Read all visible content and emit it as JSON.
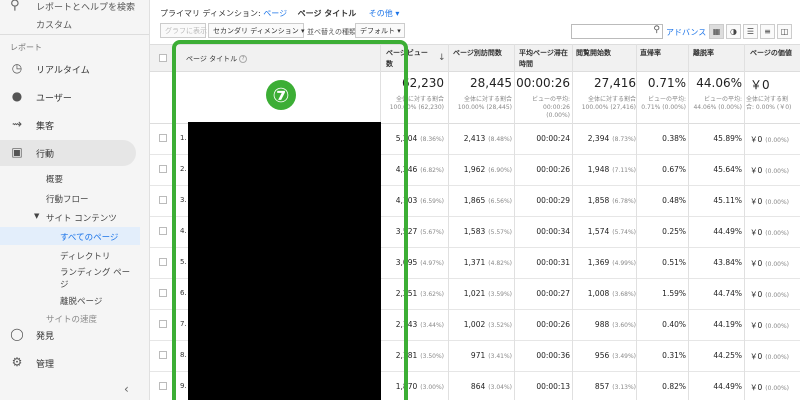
{
  "sidebar": {
    "search_text": "レポートとヘルプを検索",
    "cut_text": "カスタム",
    "section_label": "レポート",
    "items": [
      {
        "label": "リアルタイム",
        "icon": "clock-icon"
      },
      {
        "label": "ユーザー",
        "icon": "person-icon"
      },
      {
        "label": "集客",
        "icon": "acquisition-icon"
      },
      {
        "label": "行動",
        "icon": "behavior-icon"
      }
    ],
    "sub_items": {
      "overview": "概要",
      "flow": "行動フロー",
      "site_content": "サイト コンテンツ",
      "all_pages": "すべてのページ",
      "directory": "ディレクトリ",
      "landing_1": "ランディング ペー",
      "landing_2": "ジ",
      "exit": "離脱ページ",
      "site_speed": "サイトの速度"
    },
    "discover": "発見",
    "admin": "管理"
  },
  "dimbar": {
    "primary": "プライマリ ディメンション:",
    "page_link": "ページ",
    "page_title": "ページ タイトル",
    "other": "その他"
  },
  "toolbar": {
    "plot_rows": "グラフに表示",
    "secondary": "セカンダリ ディメンション",
    "sort_label": "並べ替えの種類:",
    "sort_value": "デフォルト",
    "advanced": "アドバンス"
  },
  "table": {
    "headers": {
      "page_title": "ページ タイトル",
      "pageviews": "ページビュー数",
      "unique": "ページ別訪問数",
      "avg_time_1": "平均ページ滞在",
      "avg_time_2": "時間",
      "entrances": "閲覧開始数",
      "bounce": "直帰率",
      "exit": "離脱率",
      "value": "ページの価値"
    },
    "totals": {
      "pageviews": "62,230",
      "pageviews_sub1": "全体に対する割合",
      "pageviews_sub2": "100.00% (62,230)",
      "unique": "28,445",
      "unique_sub1": "全体に対する割合",
      "unique_sub2": "100.00% (28,445)",
      "avg": "00:00:26",
      "avg_sub1": "ビューの平均:",
      "avg_sub2": "00:00:26",
      "avg_sub3": "(0.00%)",
      "entrances": "27,416",
      "entrances_sub1": "全体に対する割合",
      "entrances_sub2": "100.00% (27,416)",
      "bounce": "0.71%",
      "bounce_sub1": "ビューの平均:",
      "bounce_sub2": "0.71% (0.00%)",
      "exit": "44.06%",
      "exit_sub1": "ビューの平均:",
      "exit_sub2": "44.06% (0.00%)",
      "value": "￥0",
      "value_sub1": "全体に対する割",
      "value_sub2": "合: 0.00% (￥0)"
    },
    "rows": [
      {
        "idx": "1.",
        "pv": "5,204",
        "pv_pct": "(8.36%)",
        "uq": "2,413",
        "uq_pct": "(8.48%)",
        "avg": "00:00:24",
        "en": "2,394",
        "en_pct": "(8.73%)",
        "br": "0.38%",
        "ex": "45.89%",
        "val": "￥0",
        "val_pct": "(0.00%)"
      },
      {
        "idx": "2.",
        "pv": "4,246",
        "pv_pct": "(6.82%)",
        "uq": "1,962",
        "uq_pct": "(6.90%)",
        "avg": "00:00:26",
        "en": "1,948",
        "en_pct": "(7.11%)",
        "br": "0.67%",
        "ex": "45.64%",
        "val": "￥0",
        "val_pct": "(0.00%)"
      },
      {
        "idx": "3.",
        "pv": "4,103",
        "pv_pct": "(6.59%)",
        "uq": "1,865",
        "uq_pct": "(6.56%)",
        "avg": "00:00:29",
        "en": "1,858",
        "en_pct": "(6.78%)",
        "br": "0.48%",
        "ex": "45.11%",
        "val": "￥0",
        "val_pct": "(0.00%)"
      },
      {
        "idx": "4.",
        "pv": "3,527",
        "pv_pct": "(5.67%)",
        "uq": "1,583",
        "uq_pct": "(5.57%)",
        "avg": "00:00:34",
        "en": "1,574",
        "en_pct": "(5.74%)",
        "br": "0.25%",
        "ex": "44.49%",
        "val": "￥0",
        "val_pct": "(0.00%)"
      },
      {
        "idx": "5.",
        "pv": "3,095",
        "pv_pct": "(4.97%)",
        "uq": "1,371",
        "uq_pct": "(4.82%)",
        "avg": "00:00:31",
        "en": "1,369",
        "en_pct": "(4.99%)",
        "br": "0.51%",
        "ex": "43.84%",
        "val": "￥0",
        "val_pct": "(0.00%)"
      },
      {
        "idx": "6.",
        "pv": "2,251",
        "pv_pct": "(3.62%)",
        "uq": "1,021",
        "uq_pct": "(3.59%)",
        "avg": "00:00:27",
        "en": "1,008",
        "en_pct": "(3.68%)",
        "br": "1.59%",
        "ex": "44.74%",
        "val": "￥0",
        "val_pct": "(0.00%)"
      },
      {
        "idx": "7.",
        "pv": "2,143",
        "pv_pct": "(3.44%)",
        "uq": "1,002",
        "uq_pct": "(3.52%)",
        "avg": "00:00:26",
        "en": "988",
        "en_pct": "(3.60%)",
        "br": "0.40%",
        "ex": "44.19%",
        "val": "￥0",
        "val_pct": "(0.00%)"
      },
      {
        "idx": "8.",
        "pv": "2,181",
        "pv_pct": "(3.50%)",
        "uq": "971",
        "uq_pct": "(3.41%)",
        "avg": "00:00:36",
        "en": "956",
        "en_pct": "(3.49%)",
        "br": "0.31%",
        "ex": "44.25%",
        "val": "￥0",
        "val_pct": "(0.00%)"
      },
      {
        "idx": "9.",
        "pv": "1,870",
        "pv_pct": "(3.00%)",
        "uq": "864",
        "uq_pct": "(3.04%)",
        "avg": "00:00:13",
        "en": "857",
        "en_pct": "(3.13%)",
        "br": "0.82%",
        "ex": "44.49%",
        "val": "￥0",
        "val_pct": "(0.00%)"
      }
    ]
  },
  "annotation": {
    "badge": "⑦",
    "color": "#3cae35"
  }
}
